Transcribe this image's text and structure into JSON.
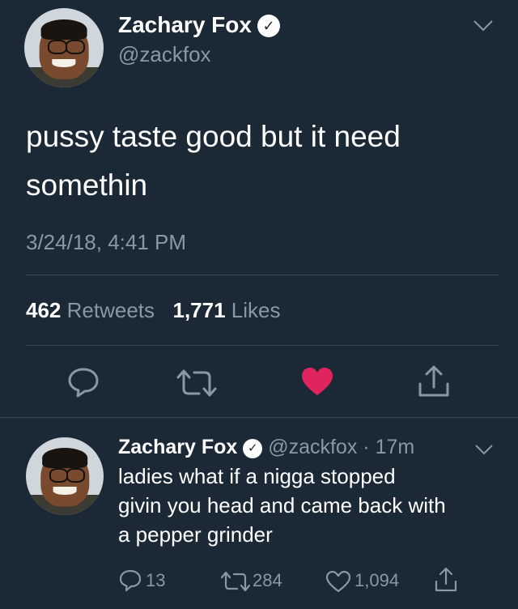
{
  "tweet": {
    "author_name": "Zachary Fox",
    "handle": "@zackfox",
    "verified_glyph": "✓",
    "text_line1": "pussy taste good but it need",
    "text_line2": "somethin",
    "timestamp": "3/24/18, 4:41 PM",
    "retweet_count": "462",
    "retweet_label": "Retweets",
    "like_count": "1,771",
    "like_label": "Likes",
    "liked": true
  },
  "reply": {
    "author_name": "Zachary Fox",
    "handle": "@zackfox",
    "separator": "·",
    "age": "17m",
    "verified_glyph": "✓",
    "text_line1": "ladies what if a nigga stopped",
    "text_line2": "givin you head and came back with",
    "text_line3": "a pepper grinder",
    "reply_count": "13",
    "retweet_count": "284",
    "like_count": "1,094"
  },
  "colors": {
    "background": "#1b2836",
    "secondary_text": "#8899a6",
    "divider": "#38444d",
    "like_red": "#e0245e"
  },
  "icons": [
    "chevron-down-icon",
    "verified-badge-icon",
    "reply-icon",
    "retweet-icon",
    "heart-icon",
    "share-icon"
  ]
}
